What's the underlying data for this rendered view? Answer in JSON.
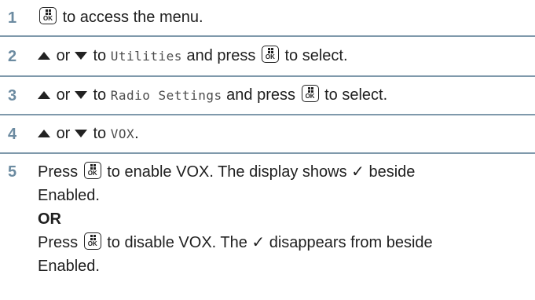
{
  "steps": [
    {
      "number": "1",
      "text_a": "to access the menu."
    },
    {
      "number": "2",
      "or_word": "or",
      "to_word": "to",
      "menu_item": "Utilities",
      "press_word": "and press",
      "action": "to select."
    },
    {
      "number": "3",
      "or_word": "or",
      "to_word": "to",
      "menu_item": "Radio Settings",
      "press_word": "and press",
      "action": "to select."
    },
    {
      "number": "4",
      "or_word": "or",
      "to_word": "to",
      "menu_item": "VOX",
      "end": "."
    },
    {
      "number": "5",
      "line1_press": "Press",
      "line1_rest": "to enable VOX. The display shows ✓ beside",
      "line2": "Enabled.",
      "or_label": "OR",
      "line4_press": "Press",
      "line4_rest": "to disable VOX. The ✓ disappears from beside",
      "line5": "Enabled."
    }
  ],
  "ok_button": {
    "label": "OK"
  },
  "colors": {
    "step_number": "#6c8ba1",
    "divider": "#7f99ab",
    "text": "#1f1f1f"
  }
}
